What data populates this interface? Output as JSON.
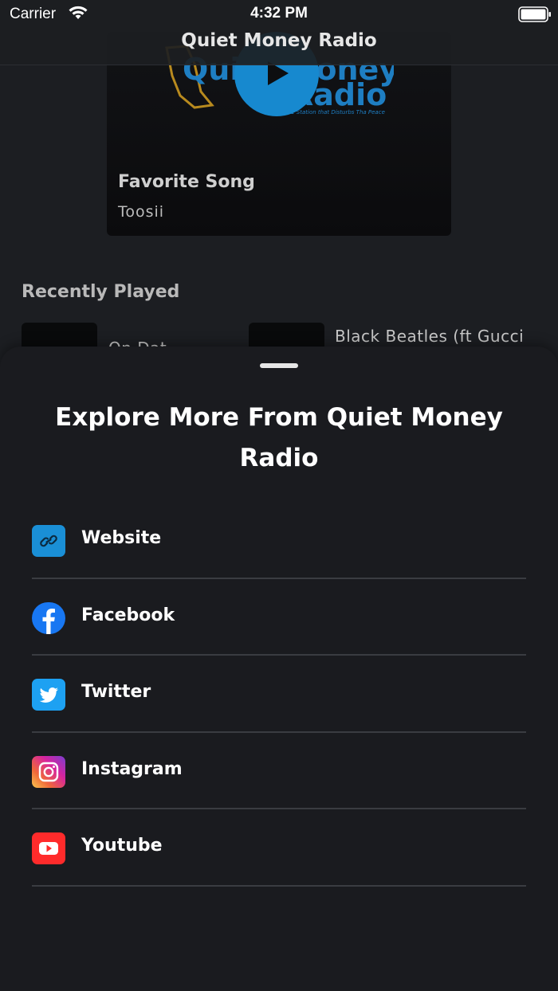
{
  "status_bar": {
    "carrier": "Carrier",
    "time": "4:32 PM"
  },
  "nav": {
    "title": "Quiet Money Radio"
  },
  "now_playing": {
    "logo_text_top": "Quiet Money",
    "logo_text_bottom": "Radio",
    "logo_tagline": "Tha #1 Station that Disturbs Tha Peace",
    "song_title": "Favorite Song",
    "artist": "Toosii"
  },
  "recently_played": {
    "heading": "Recently Played",
    "items": [
      {
        "title": "On Dat"
      },
      {
        "title": "Black Beatles (ft Gucci"
      }
    ]
  },
  "sheet": {
    "title": "Explore More From Quiet Money Radio",
    "links": [
      {
        "label": "Website",
        "icon": "link-icon",
        "color": "#1a8fd6"
      },
      {
        "label": "Facebook",
        "icon": "facebook-icon",
        "color": "#1877f2"
      },
      {
        "label": "Twitter",
        "icon": "twitter-icon",
        "color": "#1da1f2"
      },
      {
        "label": "Instagram",
        "icon": "instagram-icon",
        "color": "#d6249f"
      },
      {
        "label": "Youtube",
        "icon": "youtube-icon",
        "color": "#ff2b2b"
      }
    ]
  }
}
